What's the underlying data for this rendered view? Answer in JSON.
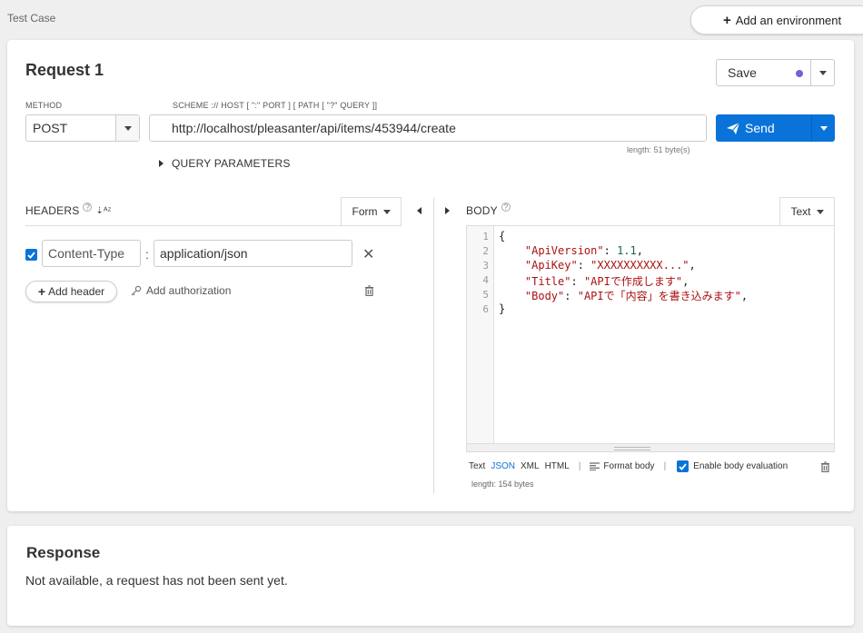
{
  "page": {
    "title": "Test Case"
  },
  "environment": {
    "add_label": "Add an environment"
  },
  "request": {
    "title": "Request 1",
    "save_label": "Save",
    "method_label": "METHOD",
    "method_value": "POST",
    "scheme_label": "SCHEME :// HOST [ \":\" PORT ] [ PATH [ \"?\" QUERY ]]",
    "url": "http://localhost/pleasanter/api/items/453944/create",
    "url_length": "length: 51 byte(s)",
    "send_label": "Send",
    "query_params_label": "QUERY PARAMETERS"
  },
  "headers": {
    "label": "HEADERS",
    "mode_label": "Form",
    "items": [
      {
        "enabled": true,
        "key": "Content-Type",
        "value": "application/json"
      }
    ],
    "add_header_label": "Add header",
    "add_auth_label": "Add authorization"
  },
  "body": {
    "label": "BODY",
    "mode_label": "Text",
    "line_numbers": [
      "1",
      "2",
      "3",
      "4",
      "5",
      "6"
    ],
    "lines": [
      {
        "open": "{"
      },
      {
        "key": "\"ApiVersion\"",
        "sep": ": ",
        "value": "1.1",
        "value_type": "num",
        "tail": ","
      },
      {
        "key": "\"ApiKey\"",
        "sep": ": ",
        "value": "\"XXXXXXXXXX...\"",
        "value_type": "str",
        "tail": ","
      },
      {
        "key": "\"Title\"",
        "sep": ": ",
        "value": "\"APIで作成します\"",
        "value_type": "str",
        "tail": ","
      },
      {
        "key": "\"Body\"",
        "sep": ": ",
        "value": "\"APIで「内容」を書き込みます\"",
        "value_type": "str",
        "tail": ","
      },
      {
        "close": "}"
      }
    ],
    "formats": [
      "Text",
      "JSON",
      "XML",
      "HTML"
    ],
    "active_format": "JSON",
    "format_body_label": "Format body",
    "enable_eval_label": "Enable body evaluation",
    "enable_eval_checked": true,
    "length": "length: 154 bytes"
  },
  "response": {
    "title": "Response",
    "message": "Not available, a request has not been sent yet."
  },
  "colors": {
    "accent": "#0a73d9",
    "save_dot": "#6f64d6",
    "code_string": "#aa1111",
    "code_number": "#116644"
  }
}
